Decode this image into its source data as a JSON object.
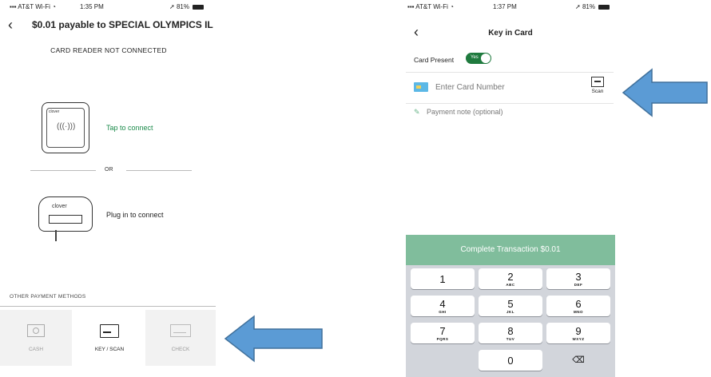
{
  "left": {
    "status": {
      "carrier": "AT&T Wi-Fi",
      "time": "1:35 PM",
      "battery": "81%"
    },
    "title": "$0.01 payable to SPECIAL OLYMPICS IL",
    "reader_status": "CARD READER NOT CONNECTED",
    "tap_device_brand": "clover",
    "tap_label": "Tap to connect",
    "or_label": "OR",
    "plug_device_brand": "clover",
    "plug_label": "Plug in to connect",
    "other_methods_header": "OTHER PAYMENT METHODS",
    "methods": [
      {
        "label": "CASH",
        "icon": "cash-icon",
        "enabled": false
      },
      {
        "label": "KEY / SCAN",
        "icon": "card-icon",
        "enabled": true
      },
      {
        "label": "CHECK",
        "icon": "check-icon",
        "enabled": false
      }
    ]
  },
  "right": {
    "status": {
      "carrier": "AT&T Wi-Fi",
      "time": "1:37 PM",
      "battery": "81%"
    },
    "title": "Key in Card",
    "card_present_label": "Card Present",
    "card_present_toggle": "Yes",
    "card_number_placeholder": "Enter Card Number",
    "scan_label": "Scan",
    "payment_note_placeholder": "Payment note (optional)",
    "complete_button": "Complete Transaction $0.01",
    "keypad": [
      {
        "digit": "1",
        "letters": ""
      },
      {
        "digit": "2",
        "letters": "ABC"
      },
      {
        "digit": "3",
        "letters": "DEF"
      },
      {
        "digit": "4",
        "letters": "GHI"
      },
      {
        "digit": "5",
        "letters": "JKL"
      },
      {
        "digit": "6",
        "letters": "MNO"
      },
      {
        "digit": "7",
        "letters": "PQRS"
      },
      {
        "digit": "8",
        "letters": "TUV"
      },
      {
        "digit": "9",
        "letters": "WXYZ"
      },
      {
        "digit": "0",
        "letters": ""
      },
      {
        "digit": "⌫",
        "letters": ""
      }
    ]
  },
  "colors": {
    "accent_green": "#1a8a4a",
    "toggle_green": "#1f7a3e",
    "complete_button": "#80bd9c",
    "arrow_fill": "#5b9bd5",
    "arrow_stroke": "#41719c",
    "keypad_bg": "#d2d5db"
  }
}
